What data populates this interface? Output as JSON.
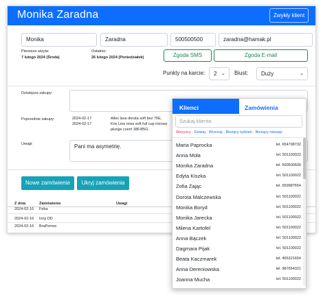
{
  "header": {
    "title": "Monika Zaradna",
    "button_label": "Zwykły klient"
  },
  "client_form": {
    "first_name": "Monika",
    "last_name": "Zaradna",
    "phone": "500500500",
    "email": "zaradna@hamak.pl",
    "first_visit_label": "Pierwsza wizyta:",
    "first_visit_value": "7 lutego 2024 (Środa)",
    "last_visit_label": "Ostatnio:",
    "last_visit_value": "26 lutego 2024 (Poniedziałek)",
    "sms_consent": "Zgoda SMS",
    "email_consent": "Zgoda E-mail",
    "points_label": "Punkty na karcie:",
    "points_value": "2",
    "bust_label": "Biust:",
    "bust_value": "Duży"
  },
  "purchases": {
    "today_label": "Dzisiejsze zakupy:",
    "previous_label": "Poprzednie zakupy:",
    "previous": [
      {
        "date": "2024-02-17",
        "desc": "Alles lava dorata soft bez 75E,"
      },
      {
        "date": "2024-02-17",
        "desc": "Kris Line miss soft full cup różowy"
      },
      {
        "date": "",
        "desc": "plunge czerń 38F/85G."
      }
    ],
    "notes_label": "Uwagi:",
    "notes_value": "Pani ma asymetrię."
  },
  "actions": {
    "new_order": "Nowe zamówienie",
    "hide_orders": "Ukryj zamówienia"
  },
  "orders_table": {
    "headers": [
      "Z dnia",
      "Zamówienie",
      "Uwagi"
    ],
    "rows": [
      {
        "date": "2024-02-16",
        "order": "Feba"
      },
      {
        "date": "2024-02-16",
        "order": "Inny DD"
      },
      {
        "date": "2024-02-16",
        "order": "BraPomoc"
      }
    ]
  },
  "popup": {
    "tab_clients": "Klienci",
    "tab_orders": "Zamówienia",
    "search_placeholder": "Szukaj klienta",
    "filters": [
      "Wszyscy",
      "Dzisiaj",
      "Wczoraj",
      "Bieżący tydzień",
      "Bieżący miesiąc"
    ],
    "selected_filter": "Wszyscy",
    "clients": [
      {
        "name": "Maria Paprocka",
        "phone": "tel. 654798732"
      },
      {
        "name": "Anna Moła",
        "phone": "tel. 501100022"
      },
      {
        "name": "Monika Zaradna",
        "phone": "tel. 500500500"
      },
      {
        "name": "Edyta Kiszka",
        "phone": "tel. 501100022"
      },
      {
        "name": "Zofia Zając",
        "phone": "tel. 659987654"
      },
      {
        "name": "Dorota Malczewska",
        "phone": "tel. 501100022"
      },
      {
        "name": "Monika Boryd",
        "phone": "tel. 501100022"
      },
      {
        "name": "Monika Jarecka",
        "phone": "tel. 501100022"
      },
      {
        "name": "Milena Kartofel",
        "phone": "tel. 501100022"
      },
      {
        "name": "Anna Bączek",
        "phone": "tel. 501100022"
      },
      {
        "name": "Dagmara Pijak",
        "phone": "tel. 501100022"
      },
      {
        "name": "Beata Kaczmarek",
        "phone": "tel. 465321654"
      },
      {
        "name": "Anna Dereniowska",
        "phone": "tel. 987654321"
      },
      {
        "name": "Joanna Mucha",
        "phone": "tel. 501100022"
      }
    ]
  },
  "colors": {
    "primary": "#0d6efd",
    "success": "#198754",
    "info": "#17a2b8",
    "danger": "#dc3545"
  }
}
